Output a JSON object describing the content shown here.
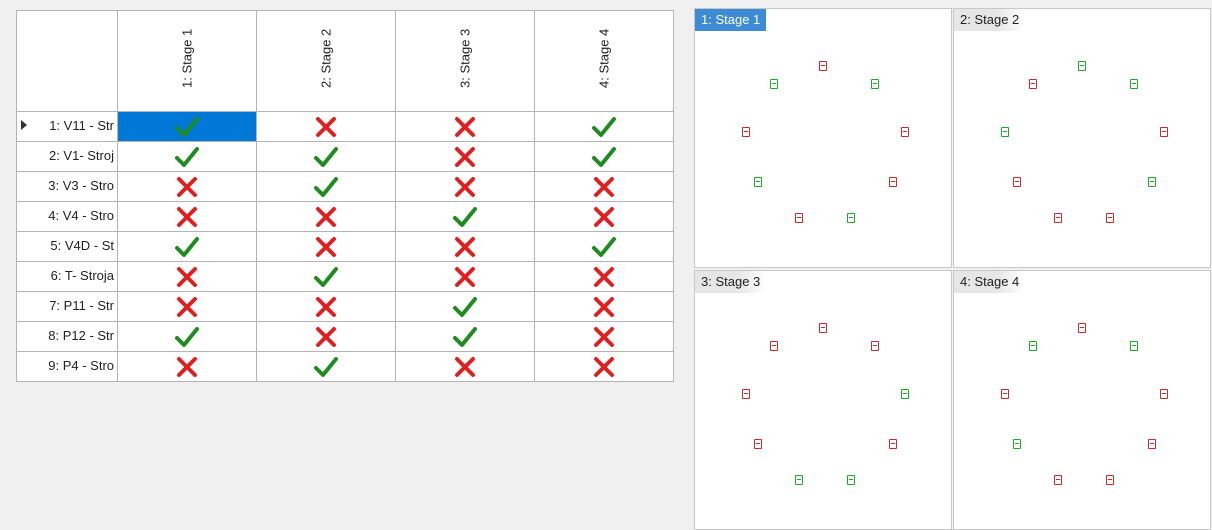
{
  "grid": {
    "columns": [
      "1: Stage 1",
      "2: Stage 2",
      "3: Stage 3",
      "4: Stage 4"
    ],
    "rows": [
      {
        "label": "1: V11 - Str",
        "current": true,
        "values": [
          "check",
          "cross",
          "cross",
          "check"
        ]
      },
      {
        "label": "2: V1- Stroj",
        "values": [
          "check",
          "check",
          "cross",
          "check"
        ]
      },
      {
        "label": "3: V3 - Stro",
        "values": [
          "cross",
          "check",
          "cross",
          "cross"
        ]
      },
      {
        "label": "4: V4 - Stro",
        "values": [
          "cross",
          "cross",
          "check",
          "cross"
        ]
      },
      {
        "label": "5: V4D - St",
        "values": [
          "check",
          "cross",
          "cross",
          "check"
        ]
      },
      {
        "label": "6: T- Stroja",
        "values": [
          "cross",
          "check",
          "cross",
          "cross"
        ]
      },
      {
        "label": "7: P11 - Str",
        "values": [
          "cross",
          "cross",
          "check",
          "cross"
        ]
      },
      {
        "label": "8: P12 - Str",
        "values": [
          "check",
          "cross",
          "check",
          "cross"
        ]
      },
      {
        "label": "9: P4 - Stro",
        "values": [
          "cross",
          "check",
          "cross",
          "cross"
        ]
      }
    ],
    "selected_cell": {
      "row": 0,
      "col": 0
    }
  },
  "panels": [
    {
      "title": "1: Stage 1",
      "active": true
    },
    {
      "title": "2: Stage 2"
    },
    {
      "title": "3: Stage 3"
    },
    {
      "title": "4: Stage 4"
    }
  ],
  "colors": {
    "check": "#1e8c1e",
    "cross": "#e02020",
    "selection": "#0078d7",
    "on": "#1ea82a",
    "off": "#cc2a2a"
  }
}
